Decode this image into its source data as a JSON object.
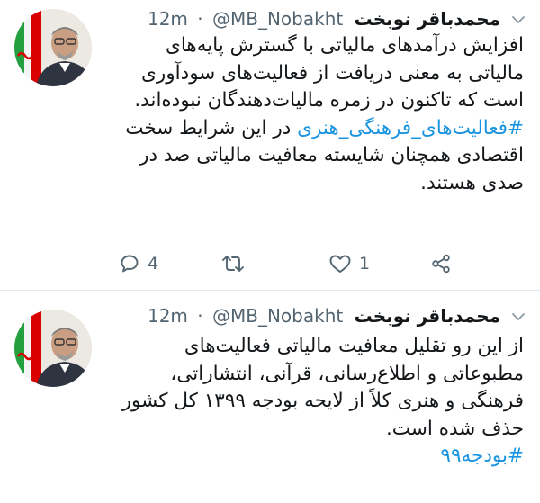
{
  "tweets": [
    {
      "author_name": "محمدباقر نوبخت",
      "handle": "@MB_Nobakht",
      "separator": "·",
      "time": "12m",
      "lines": [
        "افزایش درآمدهای مالیاتی با گسترش پایه‌های",
        "مالیاتی به معنی دریافت از فعالیت‌های سودآوری",
        "است که تاکنون در زمره مالیات‌دهندگان نبوده‌اند."
      ],
      "hashtag": "#فعالیت‌های_فرهنگی_هنری",
      "line4_rest": " در این شرایط سخت",
      "lines_after": [
        "اقتصادی همچنان شایسته معافیت مالیاتی صد در",
        "صدی هستند."
      ],
      "reply_count": "4",
      "retweet_count": "",
      "like_count": "1"
    },
    {
      "author_name": "محمدباقر نوبخت",
      "handle": "@MB_Nobakht",
      "separator": "·",
      "time": "12m",
      "lines": [
        "از این رو تقلیل معافیت مالیاتی فعالیت‌های",
        "مطبوعاتی و اطلاع‌رسانی، قرآنی، انتشاراتی،",
        "فرهنگی و هنری کلاً از لایحه بودجه ۱۳۹۹ کل کشور",
        "حذف شده است."
      ],
      "hashtag": "#بودجه۹۹"
    }
  ],
  "colors": {
    "link": "#1b95e0",
    "muted": "#536471",
    "divider": "#e1e8ed",
    "flag_green": "#239f40",
    "flag_red": "#da0000"
  },
  "icons": {
    "reply": "speech-bubble-icon",
    "retweet": "retweet-icon",
    "like": "heart-icon",
    "share": "share-icon",
    "menu": "chevron-down-icon"
  }
}
